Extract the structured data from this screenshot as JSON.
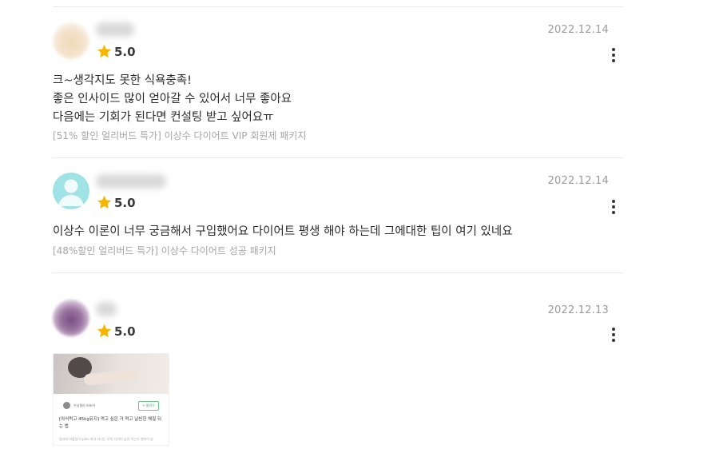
{
  "colors": {
    "star": "#f7b500",
    "divider": "#e9e9e9",
    "date": "#9a9a9a",
    "product": "#a5a5a5",
    "default_avatar": "#9fe3e7"
  },
  "reviews": [
    {
      "date": "2022.12.14",
      "rating": "5.0",
      "rating_value": 5.0,
      "content_lines": [
        "크~생각지도 못한 식욕충족!",
        "좋은 인사이드 많이 얻아갈 수 있어서 너무 좋아요",
        "다음에는 기회가 된다면 컨설팅 받고 싶어요ㅠ"
      ],
      "product": "[51% 할인 얼리버드 특가] 이상수 다이어트 VIP 회원제 패키지"
    },
    {
      "date": "2022.12.14",
      "rating": "5.0",
      "rating_value": 5.0,
      "content_lines": [
        "이상수 이론이 너무 궁금해서 구입했어요 다이어트 평생 해야 하는데 그에대한 팁이 여기 있네요"
      ],
      "product": "[48%할인 얼리버드 특가] 이상수 다이어트 성공 패키지"
    },
    {
      "date": "2022.12.13",
      "rating": "5.0",
      "rating_value": 5.0,
      "thumbnail": {
        "author": "수성필리 비포어",
        "follow": "+ 팔로우",
        "title": "[야식먹고 45kg유지] 먹고 싶은 거 먹고 날씬한 체질 되는 법",
        "desc": "필라테 마블링이 yoko 와의 다니는 토끼 다이어 습관 먹는다 멘보어 남"
      }
    }
  ]
}
